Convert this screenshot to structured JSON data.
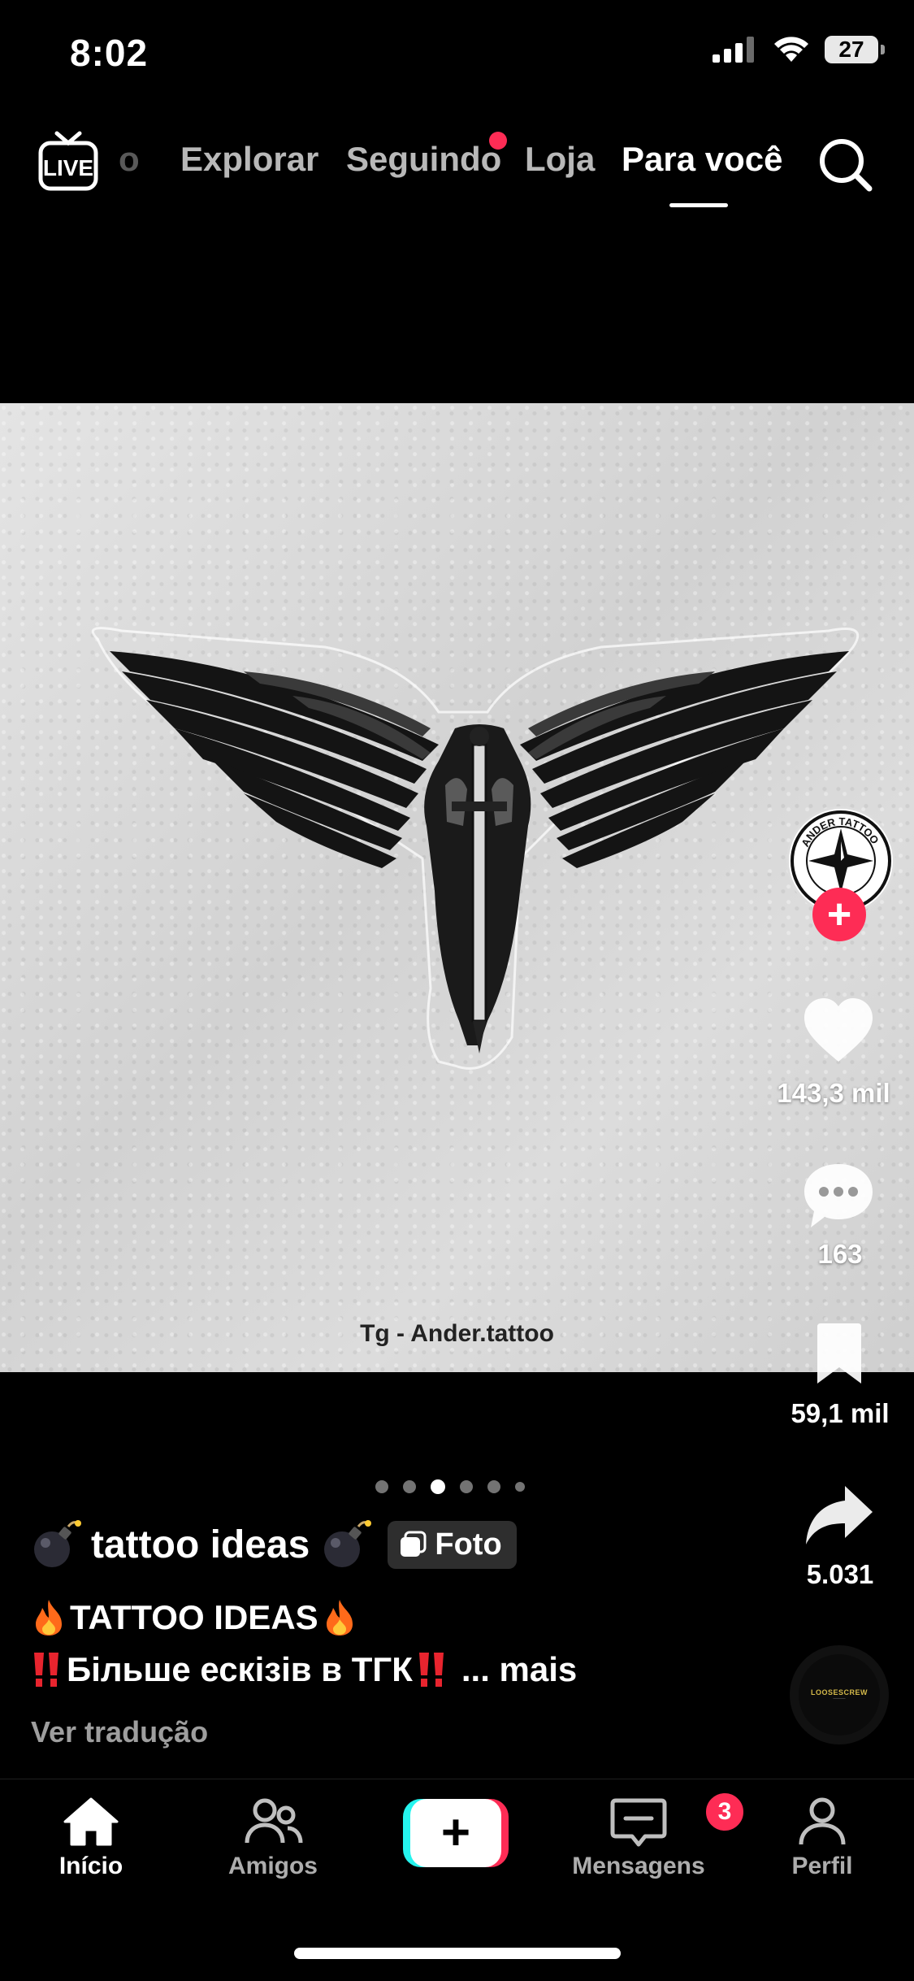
{
  "status_bar": {
    "time": "8:02",
    "battery": "27"
  },
  "top_nav": {
    "live_label": "LIVE",
    "partial_tab": "o",
    "tabs": [
      {
        "label": "Explorar"
      },
      {
        "label": "Seguindo"
      },
      {
        "label": "Loja"
      },
      {
        "label": "Para você",
        "active": true
      }
    ]
  },
  "post": {
    "image_caption": "Tg - Ander.tattoo",
    "creator_badge_text": "ANDER TATTOO",
    "likes": "143,3 mil",
    "comments": "163",
    "saves": "59,1 mil",
    "shares": "5.031",
    "carousel": {
      "count": 6,
      "active_index": 2
    },
    "author": "tattoo ideas",
    "type_badge": "Foto",
    "description_line1": "TATTOO IDEAS",
    "description_line2": "Більше ескізів в ТГК",
    "more_label": "... mais",
    "translate_label": "Ver tradução",
    "music_disc_text": "LOOSESCREW"
  },
  "tab_bar": {
    "items": [
      {
        "label": "Início",
        "active": true
      },
      {
        "label": "Amigos"
      },
      {
        "label": ""
      },
      {
        "label": "Mensagens",
        "badge": "3"
      },
      {
        "label": "Perfil"
      }
    ]
  },
  "colors": {
    "accent": "#fe2c55",
    "cyan": "#25f4ee",
    "background": "#000000"
  }
}
